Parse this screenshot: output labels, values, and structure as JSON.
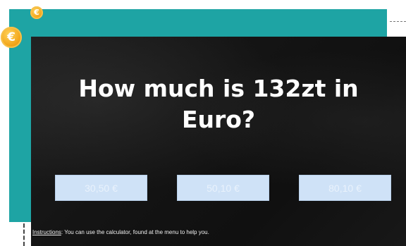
{
  "quiz": {
    "question": "How much is 132zt in Euro?",
    "answers": [
      "30,50 €",
      "50,10 €",
      "80,10 €"
    ],
    "instructions_label": "Instructions",
    "instructions_sep": ":",
    "instructions_text": " You can use the calculator, found at the menu to help you."
  },
  "decor": {
    "coin_symbol": "€",
    "teal_color": "#1ea4a4",
    "coin_color": "#f2a51a",
    "answer_color": "#cfe2f7"
  }
}
